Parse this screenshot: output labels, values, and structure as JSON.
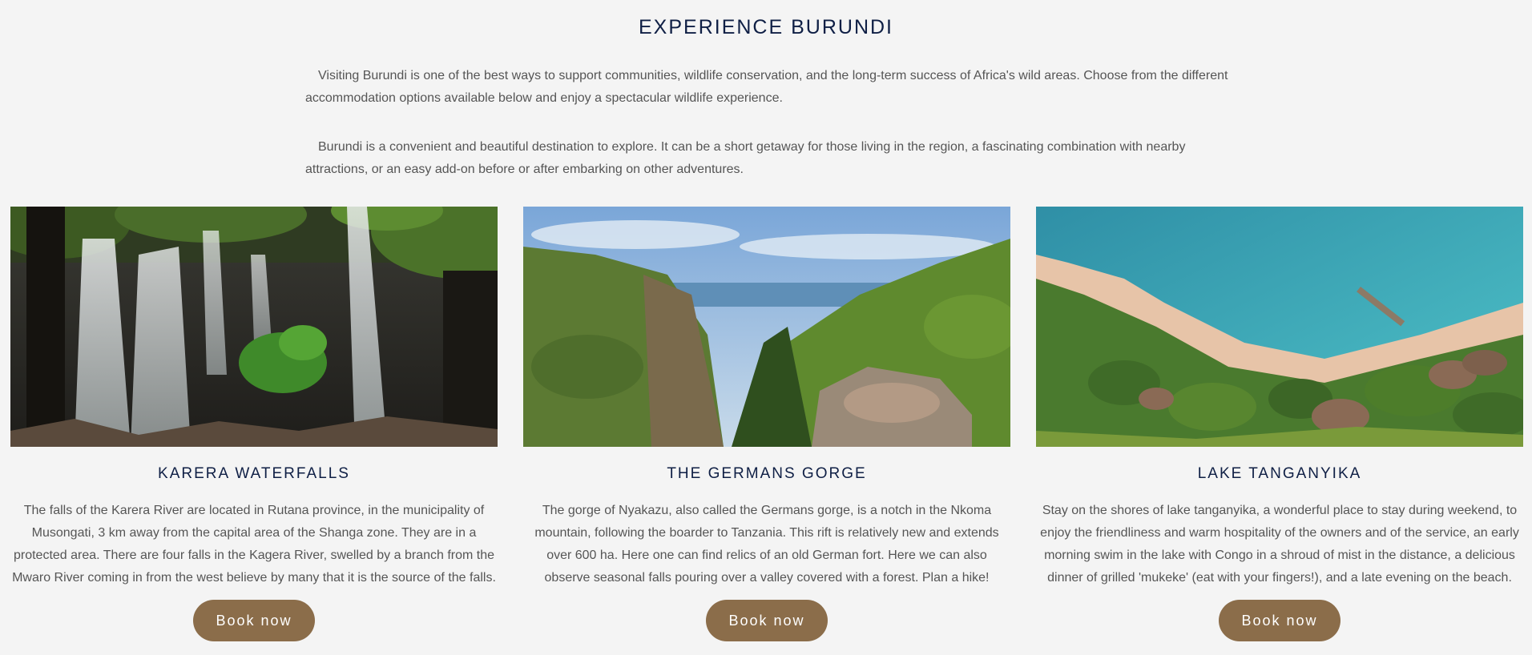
{
  "page": {
    "title": "EXPERIENCE BURUNDI",
    "intro_1": "Visiting Burundi is one of the best ways to support communities, wildlife conservation, and the long-term success of Africa's wild areas. Choose from the different accommodation options available below and enjoy a spectacular wildlife experience.",
    "intro_2": "Burundi is a convenient and beautiful destination to explore. It can be a short getaway for those living in the region, a fascinating combination with nearby attractions, or an easy add-on before or after embarking on other adventures."
  },
  "destinations": [
    {
      "title": "KARERA WATERFALLS",
      "image": "waterfall-photo",
      "text": "The falls of the Karera River are located in Rutana province, in the municipality of Musongati, 3 km away from the capital area of the Shanga zone. They are in a protected area. There are four falls in the Kagera River, swelled by a branch from the Mwaro River coming in from the west believe by many that it is the source of the falls.",
      "button": "Book now"
    },
    {
      "title": "THE GERMANS GORGE",
      "image": "gorge-photo",
      "text": "The gorge of Nyakazu, also called the Germans gorge, is a notch in the Nkoma mountain, following the boarder to Tanzania. This rift is relatively new and extends over 600 ha. Here one can find relics of an old German fort. Here we can also observe seasonal falls pouring over a valley covered with a forest. Plan a hike!",
      "button": "Book now"
    },
    {
      "title": "LAKE TANGANYIKA",
      "image": "lake-beach-photo",
      "text": "Stay on the shores of lake tanganyika, a wonderful place to stay during weekend, to enjoy the friendliness and warm hospitality of the owners and of the service, an early morning swim in the lake with Congo in a shroud of mist in the distance, a delicious dinner of grilled 'mukeke' (eat with your fingers!), and a late evening on the beach.",
      "button": "Book now"
    }
  ],
  "colors": {
    "background": "#f4f4f4",
    "heading": "#0f1f45",
    "body_text": "#555555",
    "button": "#8b6d4a",
    "button_text": "#ffffff"
  }
}
